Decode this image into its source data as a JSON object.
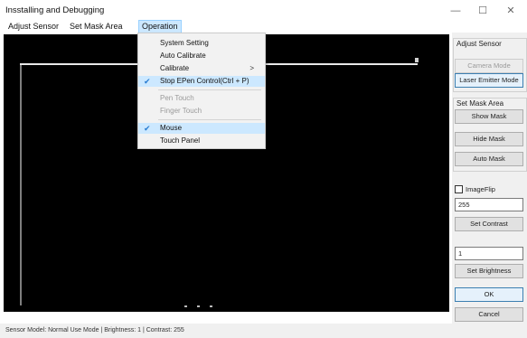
{
  "window": {
    "title": "Insstalling and Debugging",
    "minimize_glyph": "—",
    "maximize_glyph": "☐",
    "close_glyph": "✕"
  },
  "menubar": {
    "items": [
      {
        "label": "Adjust Sensor"
      },
      {
        "label": "Set Mask Area"
      },
      {
        "label": "Operation"
      }
    ]
  },
  "operation_menu": {
    "items": [
      {
        "label": "System Setting",
        "checked": false,
        "enabled": true,
        "submenu": false
      },
      {
        "label": "Auto Calibrate",
        "checked": false,
        "enabled": true,
        "submenu": false
      },
      {
        "label": "Calibrate",
        "checked": false,
        "enabled": true,
        "submenu": true,
        "arrow": ">"
      },
      {
        "label": "Stop EPen Control(Ctrl + P)",
        "checked": true,
        "enabled": true,
        "submenu": false,
        "check_glyph": "✔"
      },
      {
        "label": "Pen Touch",
        "checked": false,
        "enabled": false,
        "submenu": false
      },
      {
        "label": "Finger Touch",
        "checked": false,
        "enabled": false,
        "submenu": false
      },
      {
        "label": "Mouse",
        "checked": true,
        "enabled": true,
        "submenu": false,
        "check_glyph": "✔"
      },
      {
        "label": "Touch Panel",
        "checked": false,
        "enabled": true,
        "submenu": false
      }
    ]
  },
  "side_panel": {
    "adjust_sensor_label": "Adjust Sensor",
    "camera_mode": "Camera Mode",
    "laser_emitter_mode": "Laser Emitter Mode",
    "set_mask_area_label": "Set Mask Area",
    "show_mask": "Show Mask",
    "hide_mask": "Hide Mask",
    "auto_mask": "Auto Mask",
    "image_flip": "ImageFlip",
    "image_flip_checked": false,
    "contrast_value": "255",
    "set_contrast": "Set Contrast",
    "brightness_value": "1",
    "set_brightness": "Set Brightness",
    "ok": "OK",
    "cancel": "Cancel"
  },
  "status": {
    "text": "Sensor Model: Normal Use Mode  |  Brightness: 1  |  Contrast: 255"
  },
  "colors": {
    "canvas_bg": "#000000",
    "menu_highlight": "#cce8ff",
    "check_color": "#2a7dd1"
  }
}
